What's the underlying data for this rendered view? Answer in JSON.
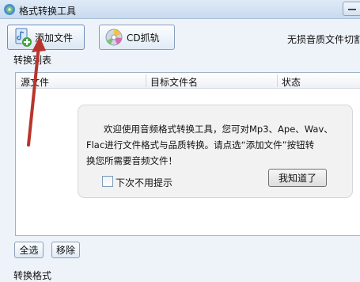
{
  "window": {
    "title": "格式转换工具",
    "icon": "app-logo-icon"
  },
  "toolbar": {
    "add_file_label": "添加文件",
    "add_file_icon": "add-file-icon",
    "cd_rip_label": "CD抓轨",
    "cd_rip_icon": "cd-icon",
    "right_text": "无损音质文件切割"
  },
  "list": {
    "group_label": "转换列表",
    "columns": [
      "源文件",
      "目标文件名",
      "状态"
    ]
  },
  "dialog": {
    "message_lines": [
      "欢迎使用音频格式转换工具，您可对Mp3、Ape、Wav、",
      "Flac进行文件格式与品质转换。请点选“添加文件”按钮转",
      "换您所需要音频文件！"
    ],
    "checkbox_label": "下次不用提示",
    "checkbox_checked": false,
    "ok_label": "我知道了"
  },
  "bottom_buttons": {
    "select_all": "全选",
    "remove": "移除"
  },
  "next_section_label": "转换格式",
  "annotation": {
    "arrow_color": "#b8352c"
  }
}
